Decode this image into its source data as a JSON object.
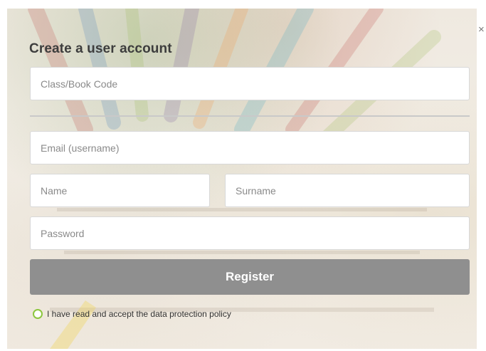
{
  "close_symbol": "×",
  "form": {
    "title": "Create a user account",
    "class_code": {
      "placeholder": "Class/Book Code",
      "value": ""
    },
    "email": {
      "placeholder": "Email (username)",
      "value": ""
    },
    "name": {
      "placeholder": "Name",
      "value": ""
    },
    "surname": {
      "placeholder": "Surname",
      "value": ""
    },
    "password": {
      "placeholder": "Password",
      "value": ""
    },
    "register_label": "Register",
    "policy_label": "I have read and accept the data protection policy"
  },
  "colors": {
    "button": "#8f8f8f",
    "radio_accent": "#8cc63e",
    "title": "#3d3d3d"
  },
  "icons": {
    "close": "close-icon",
    "policy_toggle": "radio-circle-icon"
  }
}
